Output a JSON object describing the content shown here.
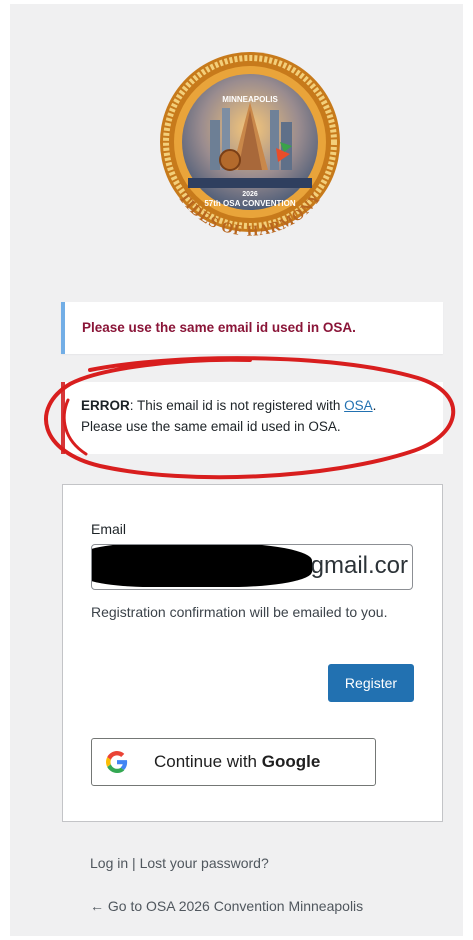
{
  "logo": {
    "top_text": "MINNEAPOLIS",
    "convention_text": "57th OSA CONVENTION",
    "year": "2026",
    "tagline": "TIDES OF HARMONY"
  },
  "notice": {
    "message": "Please use the same email id used in OSA."
  },
  "error": {
    "label": "ERROR",
    "text_before_link": ": This email id is not registered with ",
    "link_text": "OSA",
    "text_after_link": ".",
    "line2": "Please use the same email id used in OSA."
  },
  "form": {
    "email_label": "Email",
    "email_value": "g@gmail.cor",
    "hint": "Registration confirmation will be emailed to you.",
    "register_label": "Register",
    "google_prefix": "Continue with ",
    "google_brand": "Google"
  },
  "footer": {
    "login": "Log in",
    "separator": " | ",
    "lost_password": "Lost your password?",
    "back_link": "← Go to OSA 2026 Convention Minneapolis"
  },
  "colors": {
    "primary": "#2271b1",
    "notice_border": "#72aee6",
    "notice_text": "#8a1538",
    "annotation_red": "#d81e1e"
  }
}
